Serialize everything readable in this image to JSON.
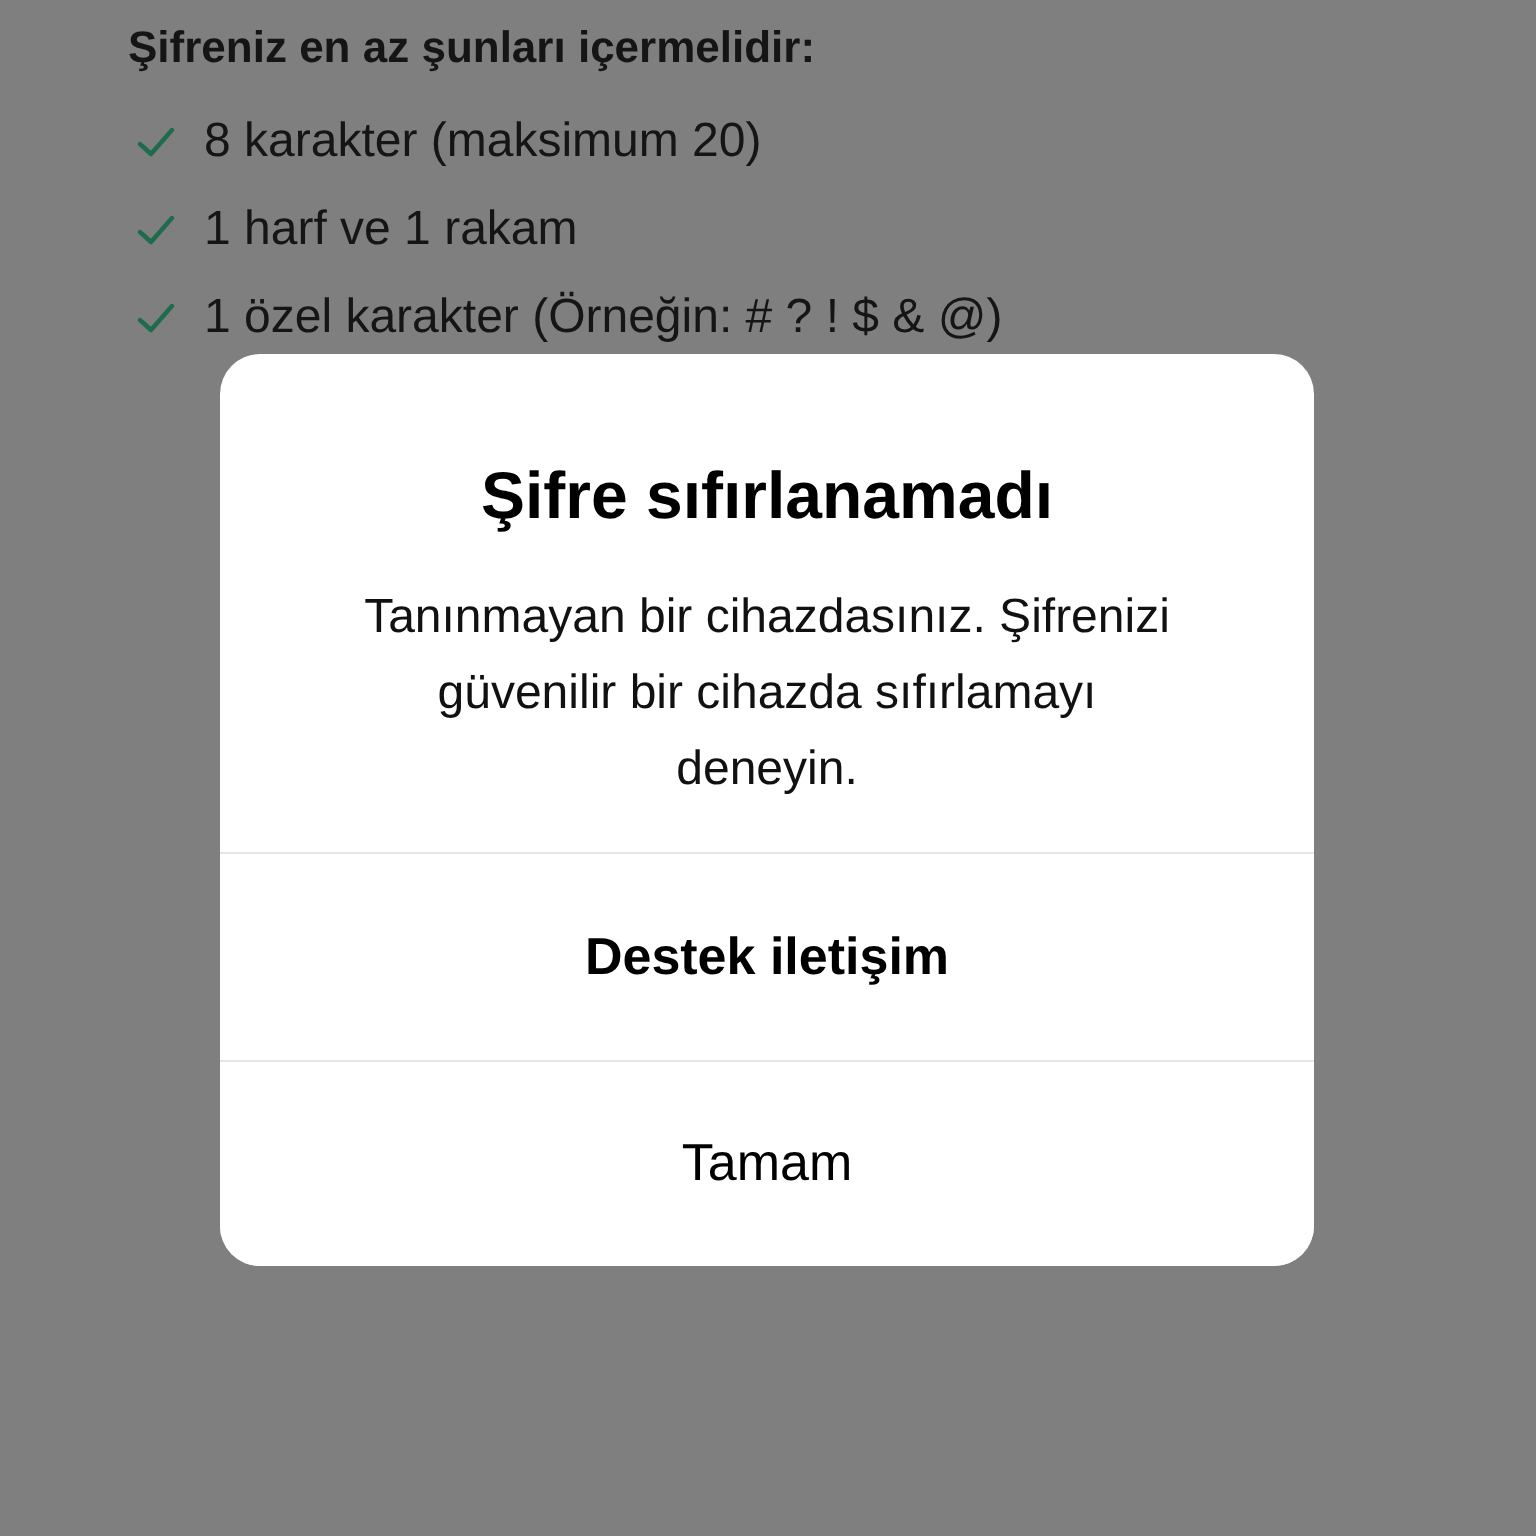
{
  "requirements": {
    "heading": "Şifreniz en az şunları içermelidir:",
    "items": [
      {
        "text": "8 karakter (maksimum 20)",
        "checked": true
      },
      {
        "text": "1 harf ve 1 rakam",
        "checked": true
      },
      {
        "text": "1 özel karakter (Örneğin: # ? ! $ & @)",
        "checked": true
      }
    ]
  },
  "alert": {
    "title": "Şifre sıfırlanamadı",
    "message": "Tanınmayan bir cihazdasınız. Şifrenizi güvenilir bir cihazda sıfırlamayı deneyin.",
    "buttons": [
      {
        "label": "Destek iletişim",
        "kind": "bold"
      },
      {
        "label": "Tamam",
        "kind": "plain"
      }
    ]
  }
}
